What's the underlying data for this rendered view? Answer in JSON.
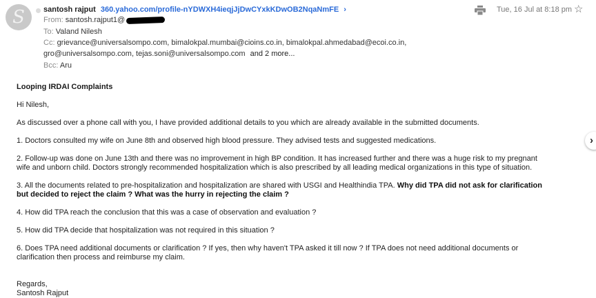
{
  "header": {
    "sender_name": "santosh rajput",
    "profile_link": "360.yahoo.com/profile-nYDWXH4ieqjJjDwCYxkKDwOB2NqaNmFE",
    "from_label": "From:",
    "from_email": "santosh.rajput1@",
    "to_label": "To:",
    "to_value": "Valand Nilesh",
    "cc_label": "Cc:",
    "cc_line1": "grievance@universalsompo.com,  bimalokpal.mumbai@cioins.co.in,  bimalokpal.ahmedabad@ecoi.co.in,",
    "cc_line2": "gro@universalsompo.com,  tejas.soni@universalsompo.com",
    "cc_more": "and 2 more...",
    "bcc_label": "Bcc:",
    "bcc_value": "Aru",
    "date": "Tue, 16 Jul at 8:18 pm",
    "avatar_letter": "S"
  },
  "icons": {
    "print": "printer-icon",
    "star": "star-icon",
    "next": "chevron-right-icon",
    "profile_chevron": "chevron-right-icon"
  },
  "email": {
    "subject": "Looping IRDAI Complaints",
    "greeting": "Hi Nilesh,",
    "intro": "As discussed over a phone call with you, I have provided additional details to you which are already available in the submitted documents.",
    "p1": "1. Doctors consulted my wife on June 8th and observed high blood pressure. They advised tests and suggested medications.",
    "p2_line1": "2. Follow-up was done on June 13th and there was no improvement in high BP condition. It has increased further and there was a huge risk to my pregnant",
    "p2_line2": "wife and unborn child. Doctors strongly recommended hospitalization which is also prescribed by all leading medical organizations in this type of situation.",
    "p3_normal": "3. All the documents related to pre-hospitalization and hospitalization are shared with USGI and Healthindia TPA. ",
    "p3_bold_line1": "Why did TPA did not ask for clarification",
    "p3_bold_line2": "but decided to reject the claim ? What was the hurry in rejecting the claim ?",
    "p4": "4. How did TPA reach the conclusion that this was a case of observation and evaluation ?",
    "p5": "5. How did TPA decide that hospitalization was not required in this situation ?",
    "p6_line1": "6. Does TPA need additional documents or clarification ? If yes, then why haven't TPA asked it till now ? If TPA does not need additional documents or",
    "p6_line2": "clarification then process and reimburse my claim.",
    "regards": "Regards,",
    "signature": "Santosh Rajput"
  },
  "colors": {
    "link": "#2a6ad8",
    "label_gray": "#8a8a8a",
    "text": "#1f1f1f"
  }
}
